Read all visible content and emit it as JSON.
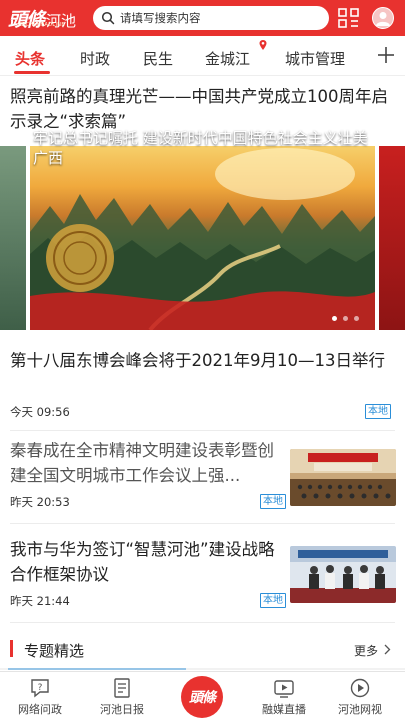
{
  "header": {
    "logo_mark": "頭條",
    "logo_city": "河池",
    "logo_sub": "HECHI HEADLINE",
    "search_placeholder": "请填写搜索内容",
    "accent": "#e8322f"
  },
  "tabs": [
    {
      "label": "头条",
      "active": true
    },
    {
      "label": "时政",
      "active": false
    },
    {
      "label": "民生",
      "active": false
    },
    {
      "label": "金城江",
      "active": false
    },
    {
      "label": "城市管理",
      "active": false
    }
  ],
  "lead": {
    "title": "照亮前路的真理光芒——中国共产党成立100周年启示录之“求索篇”"
  },
  "banner": {
    "caption": "牢记总书记嘱托  建设新时代中国特色社会主义壮美广西",
    "slides": 3,
    "active_slide": 1
  },
  "articles": [
    {
      "title": "第十八届东博会峰会将于2021年9月10—13日举行",
      "time": "今天 09:56",
      "badge": "本地"
    },
    {
      "title": "秦春成在全市精神文明建设表彰暨创建全国文明城市工作会议上强...",
      "time": "昨天 20:53",
      "badge": "本地",
      "thumb": "meeting-hall"
    },
    {
      "title": "我市与华为签订“智慧河池”建设战略合作框架协议",
      "time": "昨天 21:44",
      "badge": "本地",
      "thumb": "signing-ceremony"
    }
  ],
  "featured": {
    "title": "专题精选",
    "more": "更多"
  },
  "bottom_nav": [
    {
      "label": "网络问政",
      "icon": "question-icon"
    },
    {
      "label": "河池日报",
      "icon": "newspaper-icon"
    },
    {
      "label": "頭條",
      "icon": "home-logo"
    },
    {
      "label": "融媒直播",
      "icon": "play-icon"
    },
    {
      "label": "河池网视",
      "icon": "video-icon"
    }
  ]
}
